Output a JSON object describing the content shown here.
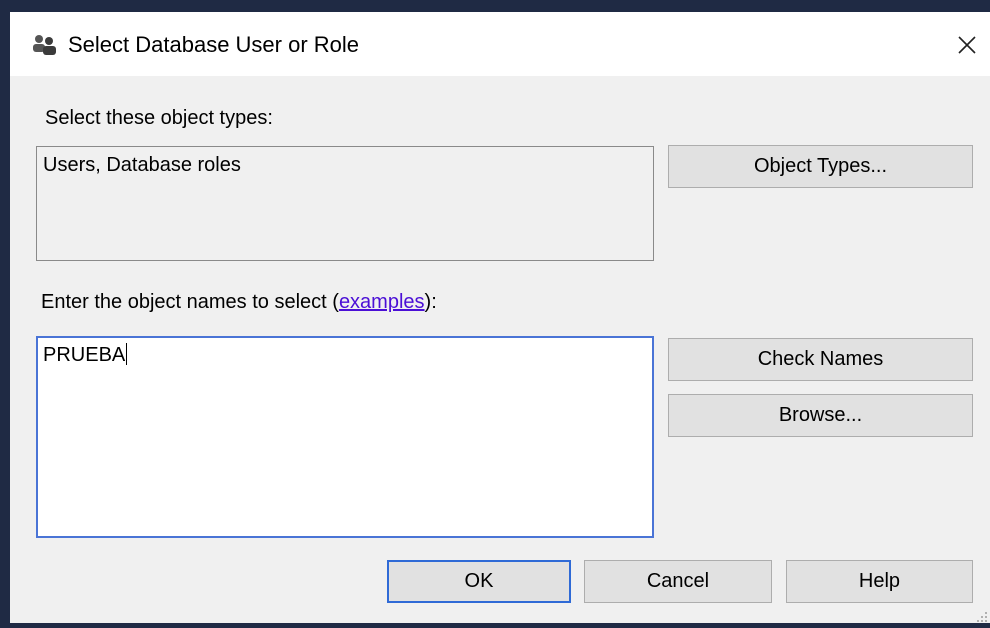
{
  "window": {
    "title": "Select Database User or Role",
    "title_icon": "users-icon",
    "close_icon": "close-icon"
  },
  "object_types": {
    "label": "Select these object types:",
    "value": "Users, Database roles",
    "button_label": "Object Types..."
  },
  "object_names": {
    "label_prefix": "Enter the object names to select (",
    "link_text": "examples",
    "label_suffix": "):",
    "value": "PRUEBA",
    "check_names_label": "Check Names",
    "browse_label": "Browse..."
  },
  "footer": {
    "ok_label": "OK",
    "cancel_label": "Cancel",
    "help_label": "Help"
  },
  "colors": {
    "accent": "#2f6ad6",
    "link": "#4b0fd6",
    "background": "#f0f0f0"
  }
}
